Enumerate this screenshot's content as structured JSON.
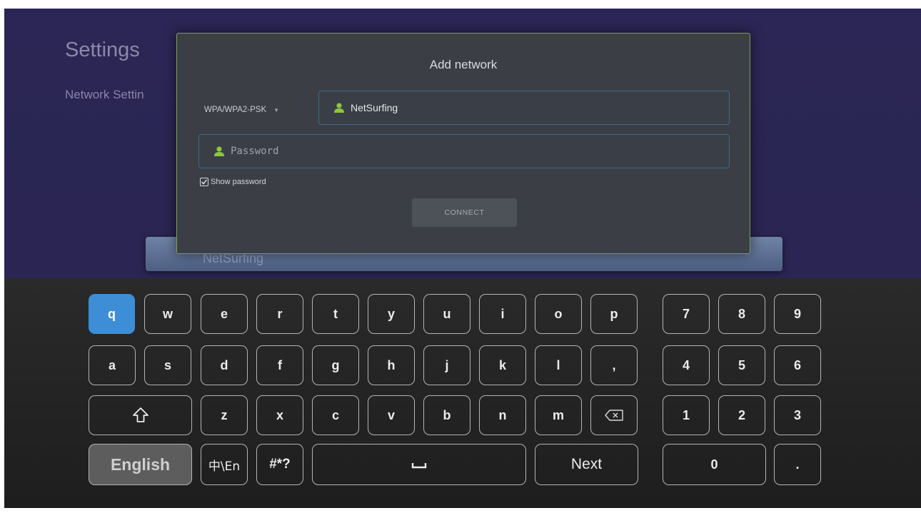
{
  "settings": {
    "title": "Settings",
    "subtitle": "Network Settin",
    "background_item_label": "NetSurfing"
  },
  "dialog": {
    "title": "Add network",
    "security": {
      "selected": "WPA/WPA2-PSK",
      "caret_icon": "dropdown-caret-icon"
    },
    "ssid": {
      "value": "NetSurfing",
      "icon": "person-icon"
    },
    "password": {
      "placeholder": "Password",
      "value": "",
      "icon": "person-icon"
    },
    "show_password": {
      "label": "Show password",
      "checked": true
    },
    "connect_label": "CONNECT"
  },
  "keyboard": {
    "row1": [
      "q",
      "w",
      "e",
      "r",
      "t",
      "y",
      "u",
      "i",
      "o",
      "p"
    ],
    "row2": [
      "a",
      "s",
      "d",
      "f",
      "g",
      "h",
      "j",
      "k",
      "l",
      ","
    ],
    "row3": [
      "z",
      "x",
      "c",
      "v",
      "b",
      "n",
      "m"
    ],
    "numpad": [
      "7",
      "8",
      "9",
      "4",
      "5",
      "6",
      "1",
      "2",
      "3"
    ],
    "active_key": "q",
    "shift_icon": "shift-icon",
    "backspace_icon": "backspace-icon",
    "language_label": "English",
    "input_mode_label": "中\\En",
    "symbols_label": "#*?",
    "space_icon": "space-icon",
    "next_label": "Next",
    "zero_label": "0",
    "dot_label": "."
  },
  "colors": {
    "background": "#2a2550",
    "dialog": "#3b3e45",
    "dialog_border": "#7da14a",
    "field_border": "#3e6a8c",
    "icon_accent": "#8dc63f",
    "active_key": "#3d8ed6"
  }
}
